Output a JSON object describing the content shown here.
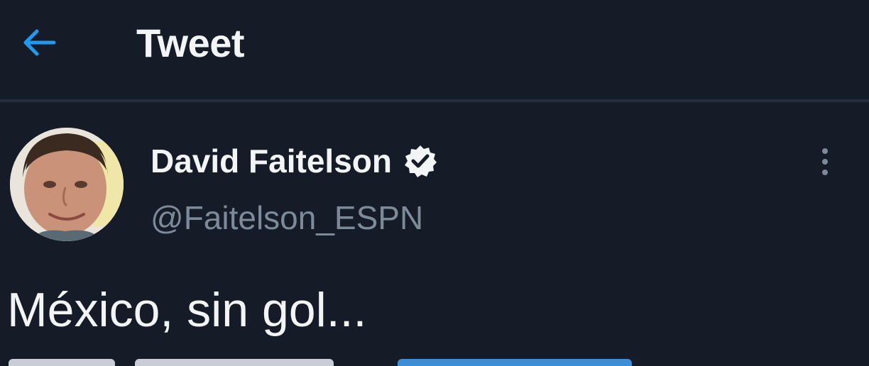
{
  "header": {
    "back_icon": "arrow-left-icon",
    "title": "Tweet"
  },
  "tweet": {
    "author": {
      "display_name": "David Faitelson",
      "handle": "@Faitelson_ESPN",
      "verified": true,
      "avatar": "avatar-photo"
    },
    "more_icon": "more-vertical-icon",
    "text": "México, sin gol..."
  },
  "colors": {
    "background": "#151c28",
    "accent": "#1d9bf0",
    "primary_text": "#f2f4f6",
    "secondary_text": "#7d8a99"
  }
}
